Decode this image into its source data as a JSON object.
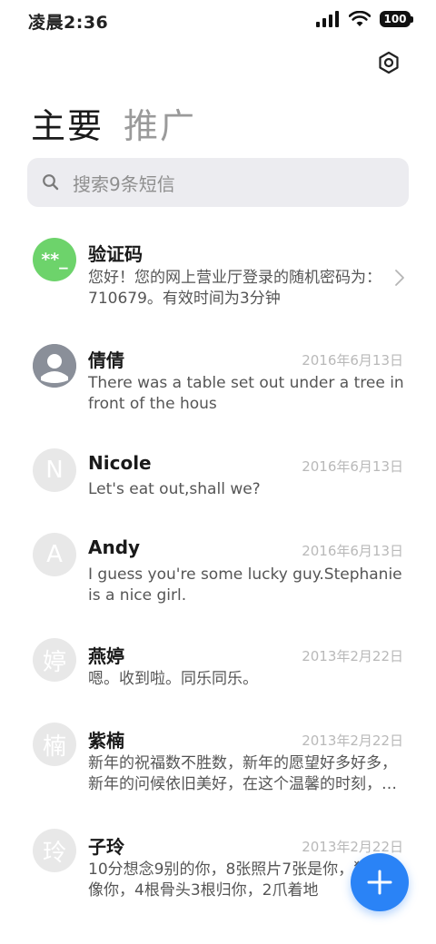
{
  "status_bar": {
    "time": "凌晨2:36",
    "battery": "100"
  },
  "tabs": [
    {
      "label": "主要",
      "active": true
    },
    {
      "label": "推广",
      "active": false
    }
  ],
  "search": {
    "placeholder": "搜索9条短信"
  },
  "messages": [
    {
      "avatar": "**_",
      "name": "验证码",
      "date": "",
      "preview": "您好！您的网上营业厅登录的随机密码为：710679。有效时间为3分钟"
    },
    {
      "avatar": "contact-icon",
      "name": "倩倩",
      "date": "2016年6月13日",
      "preview": "There was a table set out under a tree in front of the hous"
    },
    {
      "avatar": "N",
      "name": "Nicole",
      "date": "2016年6月13日",
      "preview": "Let's eat out,shall we?"
    },
    {
      "avatar": "A",
      "name": "Andy",
      "date": "2016年6月13日",
      "preview": "I guess you're some lucky guy.Stephanie is a nice girl."
    },
    {
      "avatar": "婷",
      "name": "燕婷",
      "date": "2013年2月22日",
      "preview": "嗯。收到啦。同乐同乐。"
    },
    {
      "avatar": "楠",
      "name": "紫楠",
      "date": "2013年2月22日",
      "preview": "新年的祝福数不胜数，新年的愿望好多好多，新年的问候依旧美好，在这个温馨的时刻，…"
    },
    {
      "avatar": "玲",
      "name": "子玲",
      "date": "2013年2月22日",
      "preview": "10分想念9别的你，8张照片7张是你，狗5只像你，4根骨头3根归你，2爪着地"
    }
  ],
  "colors": {
    "accent": "#2a83f6",
    "verify_avatar": "#6dd36b"
  }
}
